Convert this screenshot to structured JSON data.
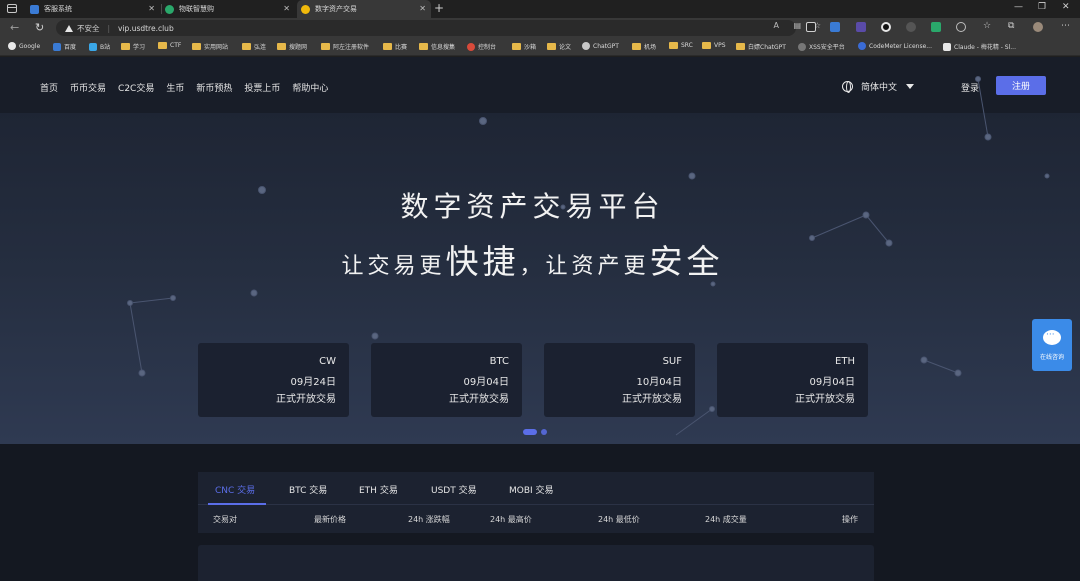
{
  "browser": {
    "tabs": [
      {
        "label": "客服系统",
        "color": "#3a7bd5"
      },
      {
        "label": "物联智慧购",
        "color": "#2aa86b"
      },
      {
        "label": "数字资产交易",
        "color": "#f0b90b"
      }
    ],
    "insecure_label": "不安全",
    "url": "vip.usdtre.club",
    "bookmarks": [
      "Google",
      "百度",
      "B站",
      "学习",
      "CTF",
      "实用网站",
      "弘连",
      "搜题网",
      "阿左注册软件",
      "比赛",
      "信息搜集",
      "控制台",
      "沙箱",
      "论文",
      "ChatGPT",
      "机场",
      "SRC",
      "VPS",
      "白嫖ChatGPT",
      "XSS安全平台",
      "CodeMeter License...",
      "Claude - 梅花精 - Sl..."
    ]
  },
  "nav": {
    "items": [
      "首页",
      "币币交易",
      "C2C交易",
      "生币",
      "新币预热",
      "投票上币",
      "帮助中心"
    ],
    "language": "简体中文",
    "login": "登录",
    "register": "注册"
  },
  "hero": {
    "title": "数字资产交易平台",
    "slogan_1": "让交易更",
    "slogan_2": "快捷",
    "slogan_3": "，让资产更",
    "slogan_4": "安全"
  },
  "listings": [
    {
      "coin": "CW",
      "date": "09月24日",
      "note": "正式开放交易"
    },
    {
      "coin": "BTC",
      "date": "09月04日",
      "note": "正式开放交易"
    },
    {
      "coin": "SUF",
      "date": "10月04日",
      "note": "正式开放交易"
    },
    {
      "coin": "ETH",
      "date": "09月04日",
      "note": "正式开放交易"
    }
  ],
  "chat": {
    "label": "在线咨询"
  },
  "market": {
    "tabs": [
      "CNC 交易",
      "BTC 交易",
      "ETH 交易",
      "USDT 交易",
      "MOBI 交易"
    ],
    "active_tab": "CNC 交易",
    "columns": [
      "交易对",
      "最新价格",
      "24h 涨跌幅",
      "24h 最高价",
      "24h 最低价",
      "24h 成交量",
      "操作"
    ]
  },
  "colors": {
    "accent": "#5b6ee8",
    "chat": "#3b8be8",
    "page_bg": "#141821"
  }
}
